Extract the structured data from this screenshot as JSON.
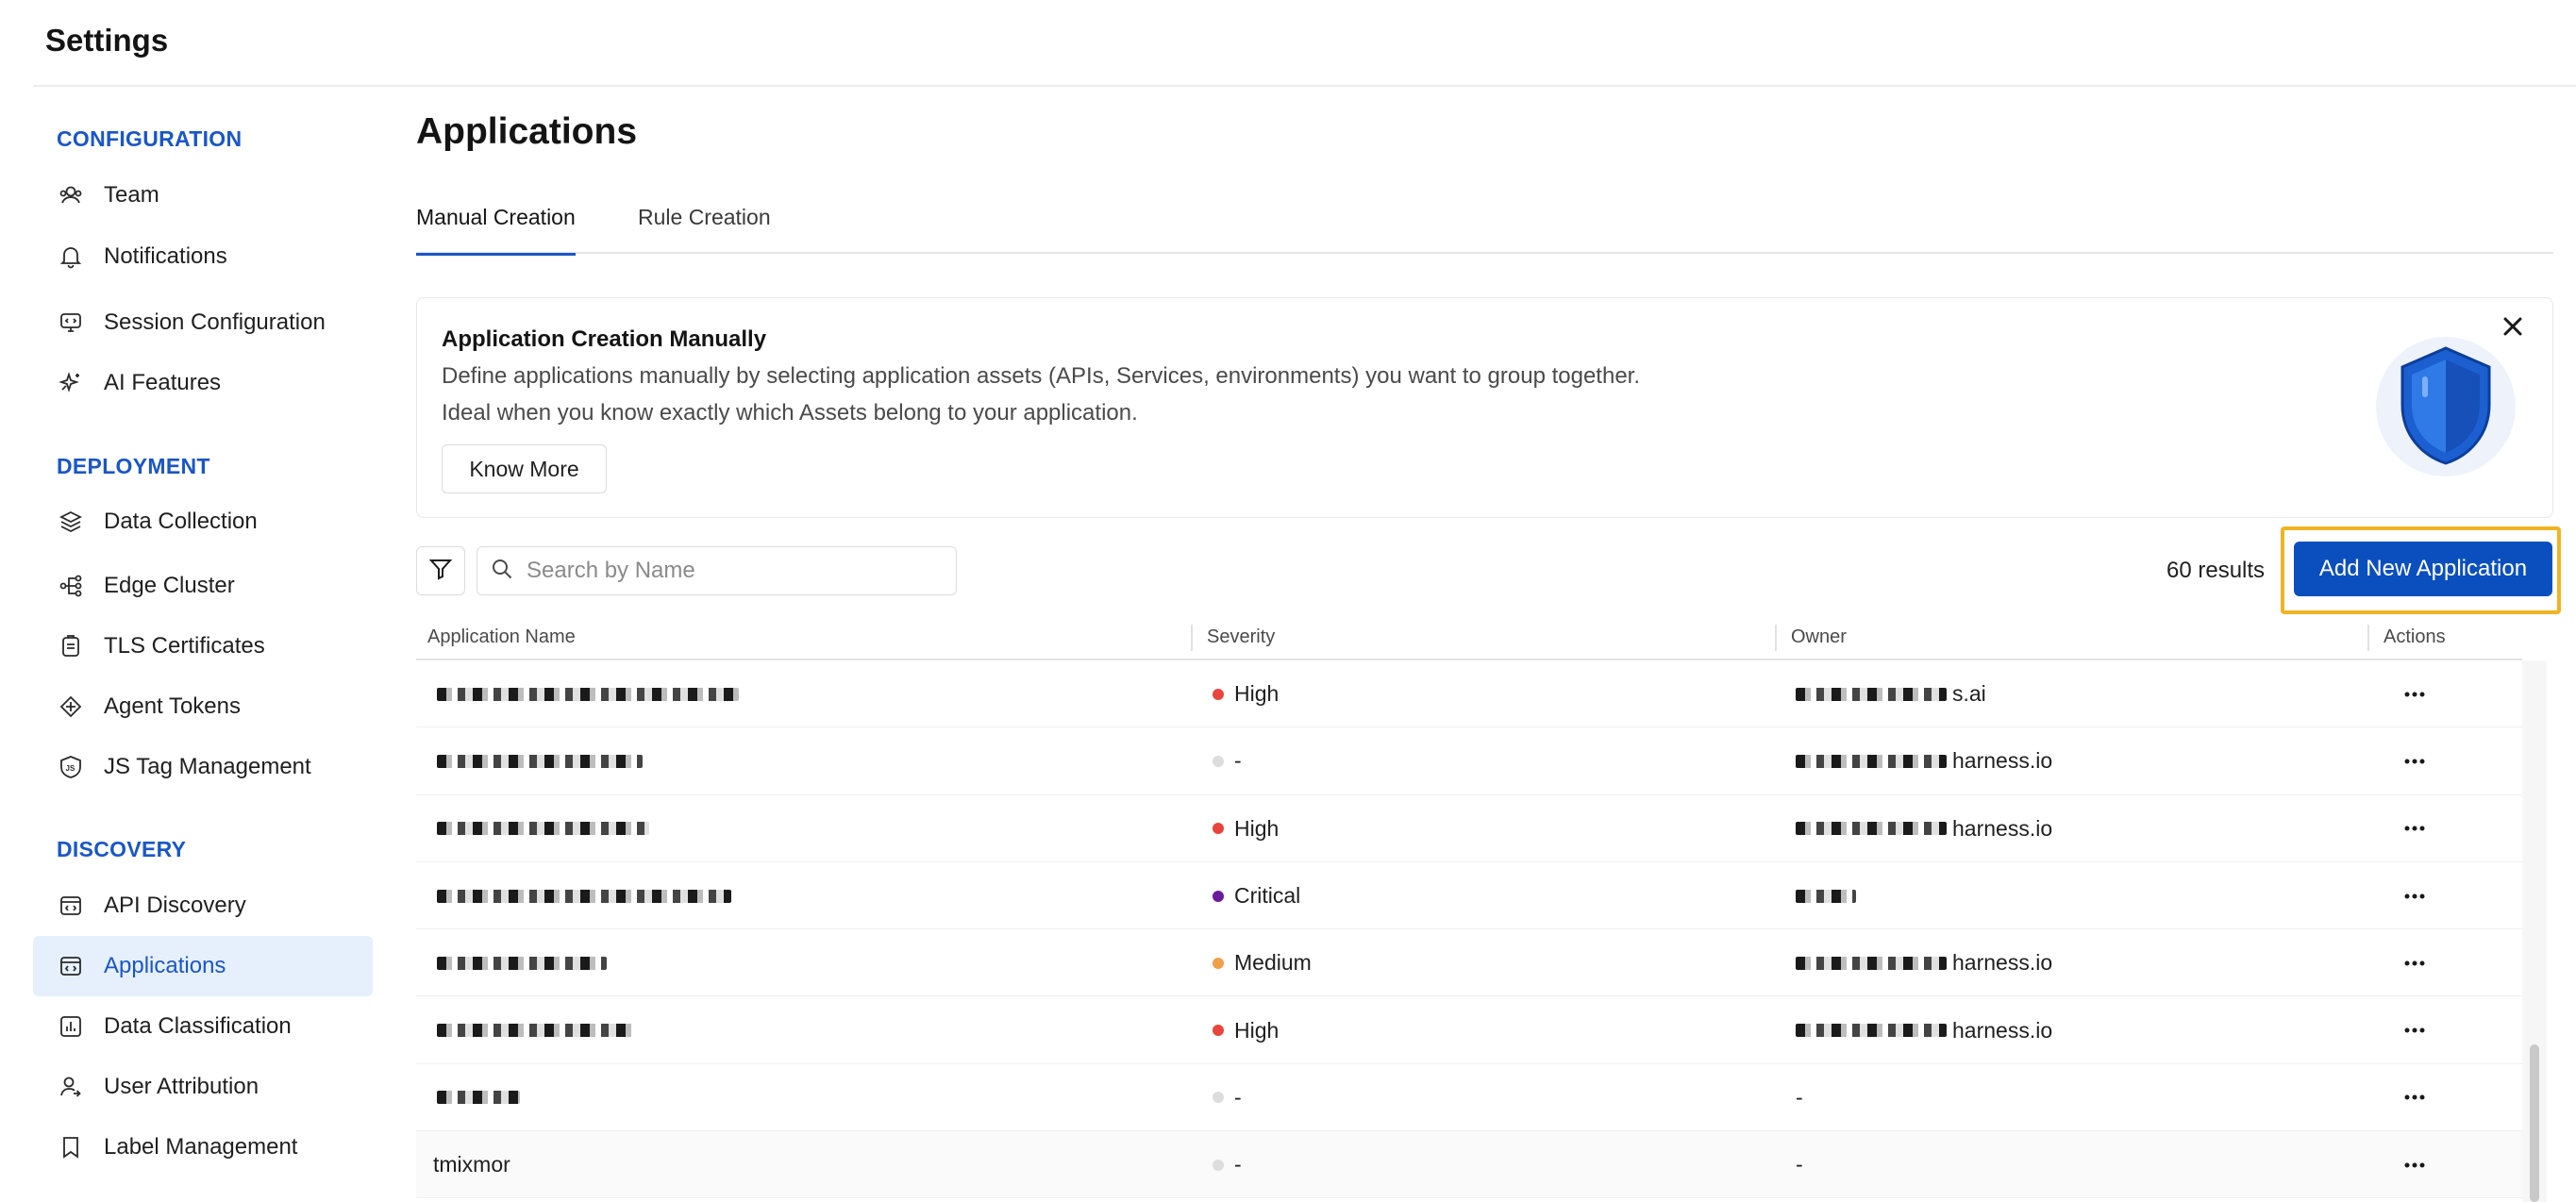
{
  "header": {
    "title": "Settings"
  },
  "sidebar": {
    "sections": [
      {
        "title": "CONFIGURATION"
      },
      {
        "title": "DEPLOYMENT"
      },
      {
        "title": "DISCOVERY"
      }
    ],
    "items": [
      {
        "label": "Team",
        "icon": "team-icon"
      },
      {
        "label": "Notifications",
        "icon": "bell-icon"
      },
      {
        "label": "Session Configuration",
        "icon": "session-icon"
      },
      {
        "label": "AI Features",
        "icon": "sparkle-icon"
      },
      {
        "label": "Data Collection",
        "icon": "layers-icon"
      },
      {
        "label": "Edge Cluster",
        "icon": "cluster-icon"
      },
      {
        "label": "TLS Certificates",
        "icon": "certificate-icon"
      },
      {
        "label": "Agent Tokens",
        "icon": "token-icon"
      },
      {
        "label": "JS Tag Management",
        "icon": "js-icon"
      },
      {
        "label": "API Discovery",
        "icon": "api-icon"
      },
      {
        "label": "Applications",
        "icon": "applications-icon",
        "active": true
      },
      {
        "label": "Data Classification",
        "icon": "chart-icon"
      },
      {
        "label": "User Attribution",
        "icon": "user-icon"
      },
      {
        "label": "Label Management",
        "icon": "bookmark-icon"
      }
    ]
  },
  "main": {
    "title": "Applications",
    "tabs": [
      {
        "label": "Manual Creation",
        "active": true
      },
      {
        "label": "Rule Creation",
        "active": false
      }
    ],
    "info_card": {
      "title": "Application Creation Manually",
      "description_line1": "Define applications manually by selecting application assets (APIs, Services, environments) you want to group together.",
      "description_line2": "Ideal when you know exactly which Assets belong to your application.",
      "button_label": "Know More"
    },
    "toolbar": {
      "search_placeholder": "Search by Name",
      "results_text": "60 results",
      "add_button_label": "Add New Application"
    },
    "table": {
      "columns": [
        "Application Name",
        "Severity",
        "Owner",
        "Actions"
      ],
      "rows": [
        {
          "name": "",
          "severity": "High",
          "severity_color": "#e8453c",
          "owner": "s.ai"
        },
        {
          "name": "",
          "severity": "-",
          "severity_color": "#dddddd",
          "owner": "harness.io"
        },
        {
          "name": "",
          "severity": "High",
          "severity_color": "#e8453c",
          "owner": "harness.io"
        },
        {
          "name": "",
          "severity": "Critical",
          "severity_color": "#6a1b9a",
          "owner": ""
        },
        {
          "name": "",
          "severity": "Medium",
          "severity_color": "#f0a04b",
          "owner": "harness.io"
        },
        {
          "name": "",
          "severity": "High",
          "severity_color": "#e8453c",
          "owner": "harness.io"
        },
        {
          "name": "",
          "severity": "-",
          "severity_color": "#dddddd",
          "owner": "-"
        },
        {
          "name": "tmixmor",
          "severity": "-",
          "severity_color": "#dddddd",
          "owner": "-"
        }
      ]
    }
  },
  "colors": {
    "accent": "#1a56c8",
    "primary_button": "#0b4fbf",
    "highlight": "#f0b323"
  }
}
